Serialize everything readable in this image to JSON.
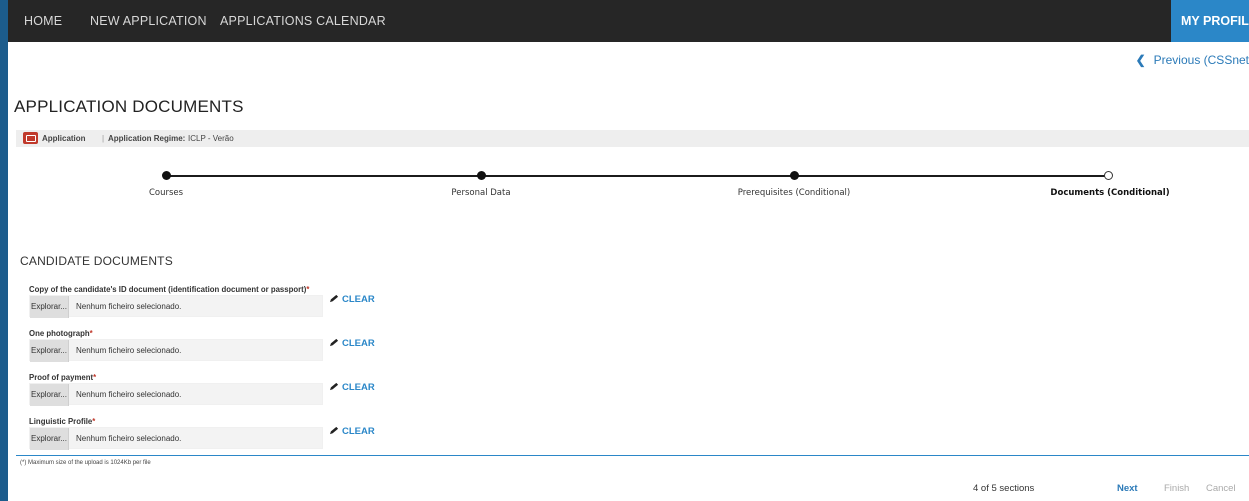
{
  "nav": {
    "items": [
      "HOME",
      "NEW APPLICATION",
      "APPLICATIONS CALENDAR"
    ],
    "profile": "MY PROFILE"
  },
  "previous_link": "Previous (CSSnet",
  "page_title": "APPLICATION DOCUMENTS",
  "app_bar": {
    "application_label": "Application",
    "separator": "|",
    "regime_label": "Application Regime:",
    "regime_value": "ICLP - Verão"
  },
  "steps": [
    {
      "label": "Courses",
      "state": "done"
    },
    {
      "label": "Personal Data",
      "state": "done"
    },
    {
      "label": "Prerequisites (Conditional)",
      "state": "done"
    },
    {
      "label": "Documents (Conditional)",
      "state": "current"
    }
  ],
  "section_title": "CANDIDATE DOCUMENTS",
  "documents": [
    {
      "label": "Copy of the candidate's ID document (identification document or passport)",
      "required_mark": "*",
      "browse": "Explorar...",
      "file": "Nenhum ficheiro selecionado.",
      "clear": "CLEAR"
    },
    {
      "label": "One photograph",
      "required_mark": "*",
      "browse": "Explorar...",
      "file": "Nenhum ficheiro selecionado.",
      "clear": "CLEAR"
    },
    {
      "label": "Proof of payment",
      "required_mark": "*",
      "browse": "Explorar...",
      "file": "Nenhum ficheiro selecionado.",
      "clear": "CLEAR"
    },
    {
      "label": "Linguistic Profile",
      "required_mark": "*",
      "browse": "Explorar...",
      "file": "Nenhum ficheiro selecionado.",
      "clear": "CLEAR"
    }
  ],
  "footnote": "(*) Maximum size of the upload is 1024Kb per file",
  "footer": {
    "sections_count": "4 of 5 sections",
    "next": "Next",
    "finish": "Finish",
    "cancel": "Cancel"
  },
  "colors": {
    "accent": "#2b87c8",
    "topbar": "#262626",
    "required": "#c0392b"
  }
}
